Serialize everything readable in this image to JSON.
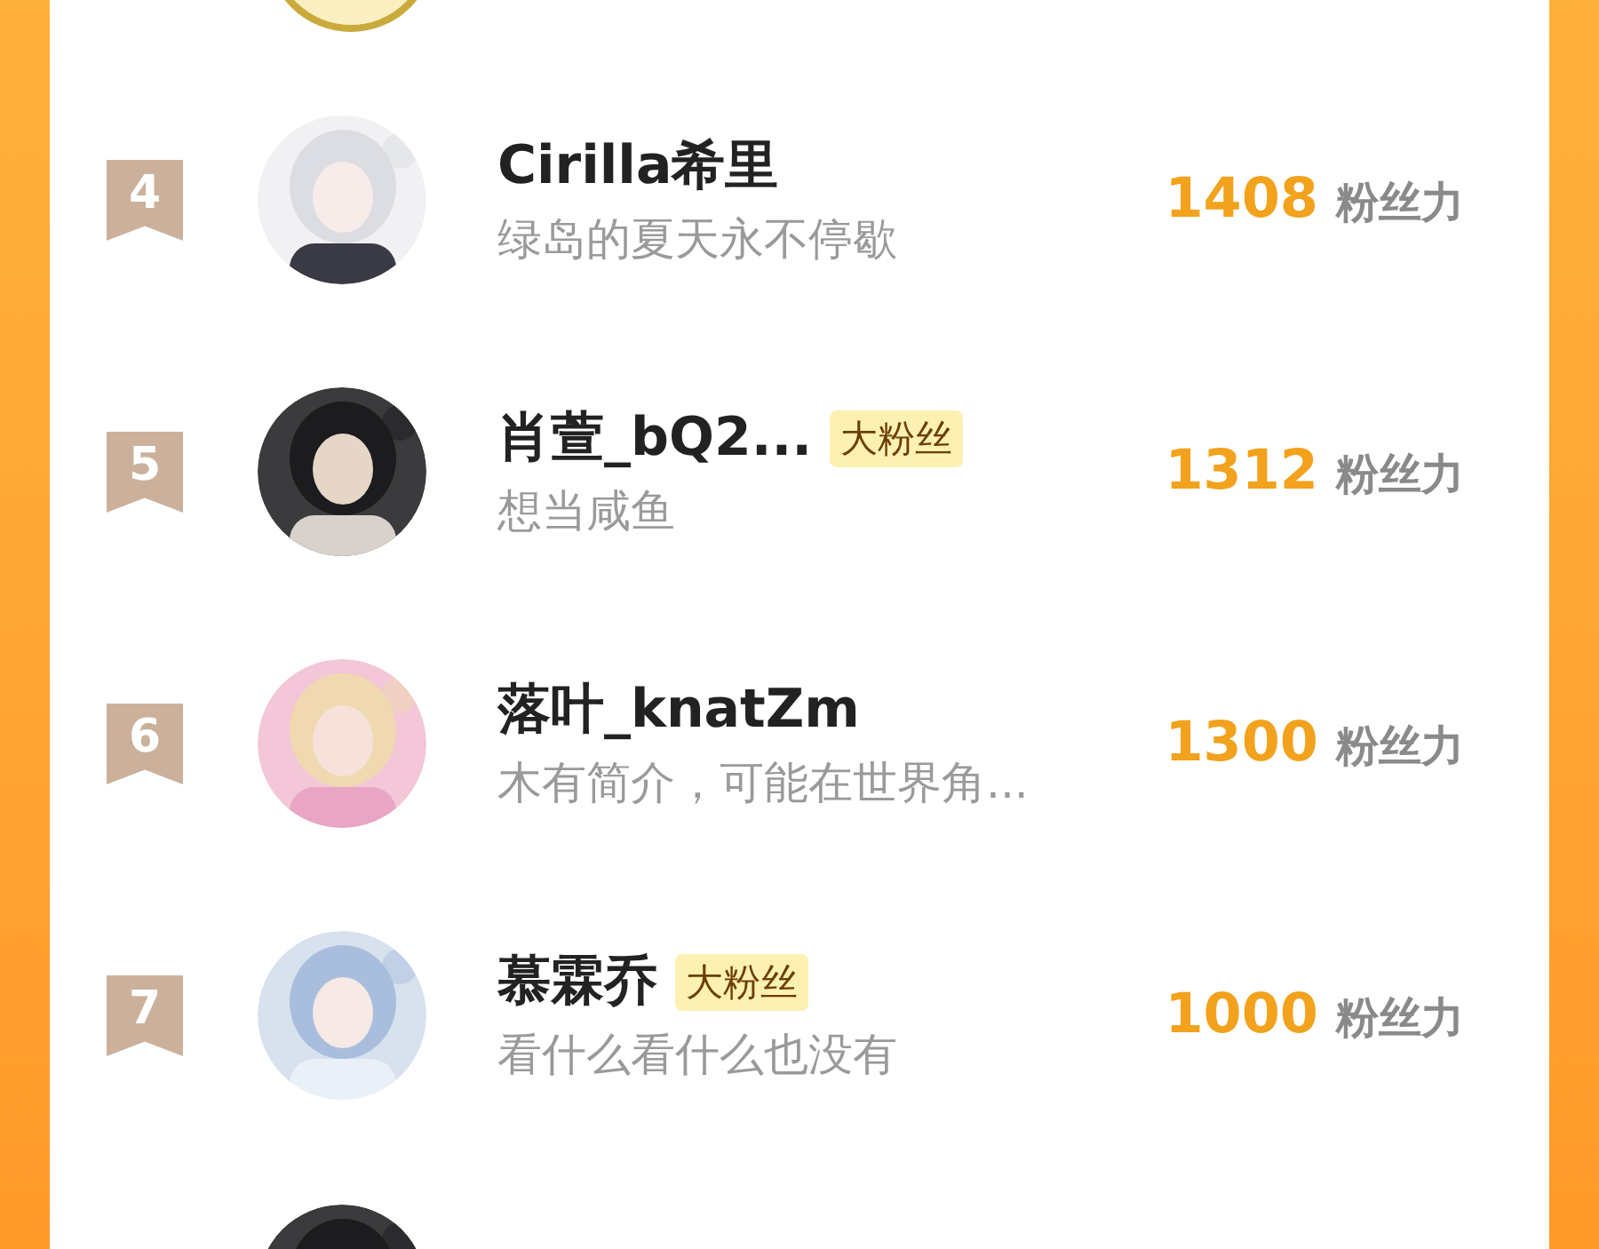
{
  "rows": [
    {
      "rank": "4",
      "name": "Cirilla希里",
      "bio": "绿岛的夏天永不停歇",
      "score": "1408",
      "score_unit": "粉丝力"
    },
    {
      "rank": "5",
      "name": "肖萱_bQ2...",
      "fan_tag": "大粉丝",
      "bio": "想当咸鱼",
      "score": "1312",
      "score_unit": "粉丝力"
    },
    {
      "rank": "6",
      "name": "落叶_knatZm",
      "bio": "木有简介，可能在世界角...",
      "score": "1300",
      "score_unit": "粉丝力"
    },
    {
      "rank": "7",
      "name": "慕霖乔",
      "fan_tag": "大粉丝",
      "bio": "看什么看什么也没有",
      "score": "1000",
      "score_unit": "粉丝力"
    }
  ]
}
